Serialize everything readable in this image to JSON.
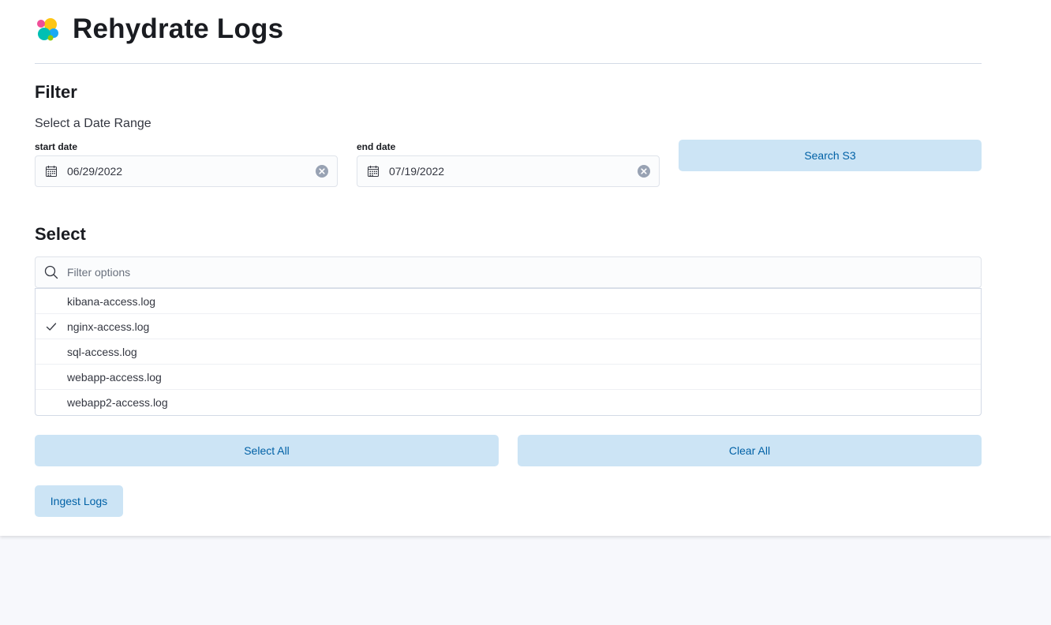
{
  "header": {
    "title": "Rehydrate Logs"
  },
  "filter": {
    "section_title": "Filter",
    "subtitle": "Select a Date Range",
    "start_label": "start date",
    "start_value": "06/29/2022",
    "end_label": "end date",
    "end_value": "07/19/2022",
    "search_button": "Search S3"
  },
  "select": {
    "section_title": "Select",
    "search_placeholder": "Filter options",
    "options": [
      {
        "label": "kibana-access.log",
        "checked": false
      },
      {
        "label": "nginx-access.log",
        "checked": true
      },
      {
        "label": "sql-access.log",
        "checked": false
      },
      {
        "label": "webapp-access.log",
        "checked": false
      },
      {
        "label": "webapp2-access.log",
        "checked": false
      }
    ],
    "select_all_button": "Select All",
    "clear_all_button": "Clear All",
    "ingest_button": "Ingest Logs"
  },
  "colors": {
    "button_bg": "#cce4f5",
    "button_text": "#0061a6",
    "logo_yellow": "#fec514",
    "logo_pink": "#f04e98",
    "logo_teal": "#00bfb3",
    "logo_blue": "#1ba9f5"
  },
  "icons": {
    "logo": "elastic-logo-icon",
    "calendar": "calendar-icon",
    "clear": "clear-circle-icon",
    "search": "search-icon",
    "check": "check-icon"
  }
}
